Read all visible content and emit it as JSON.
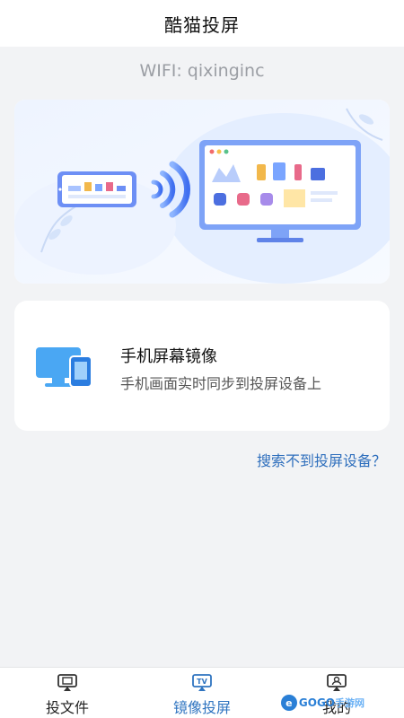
{
  "header": {
    "title": "酷猫投屏"
  },
  "wifi": {
    "text": "WIFI: qixinginc"
  },
  "mirror_card": {
    "title": "手机屏幕镜像",
    "subtitle": "手机画面实时同步到投屏设备上"
  },
  "help_link": {
    "text": "搜索不到投屏设备？"
  },
  "tabs": [
    {
      "label": "投文件",
      "icon": "file-cast-icon"
    },
    {
      "label": "镜像投屏",
      "icon": "tv-icon",
      "active": true
    },
    {
      "label": "我的",
      "icon": "profile-icon"
    }
  ],
  "watermark": {
    "circle": "e",
    "brand": "GOGO",
    "suffix": "手游网"
  },
  "colors": {
    "accent": "#2f74c0",
    "link": "#2f6fbd",
    "background": "#f2f3f5"
  }
}
